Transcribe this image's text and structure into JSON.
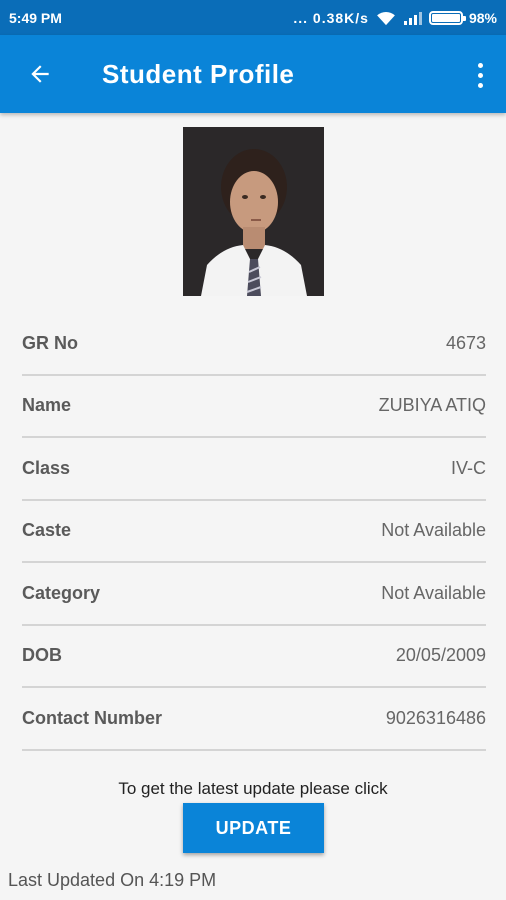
{
  "status_bar": {
    "time": "5:49 PM",
    "network_speed": "... 0.38K/s",
    "battery": "98%",
    "icons": [
      "wifi-icon",
      "signal-icon",
      "battery-icon"
    ]
  },
  "app_bar": {
    "title": "Student Profile",
    "back_icon": "arrow-back-icon",
    "menu_icon": "more-vert-icon",
    "color": "#0a84d8"
  },
  "profile": {
    "fields": [
      {
        "label": "GR No",
        "value": "4673"
      },
      {
        "label": "Name",
        "value": "ZUBIYA ATIQ"
      },
      {
        "label": "Class",
        "value": "IV-C"
      },
      {
        "label": "Caste",
        "value": "Not Available"
      },
      {
        "label": "Category",
        "value": "Not Available"
      },
      {
        "label": "DOB",
        "value": "20/05/2009"
      },
      {
        "label": "Contact Number",
        "value": "9026316486"
      }
    ]
  },
  "update": {
    "hint": "To get the latest update please click",
    "button_label": "UPDATE",
    "last_updated": "Last Updated On 4:19 PM"
  }
}
